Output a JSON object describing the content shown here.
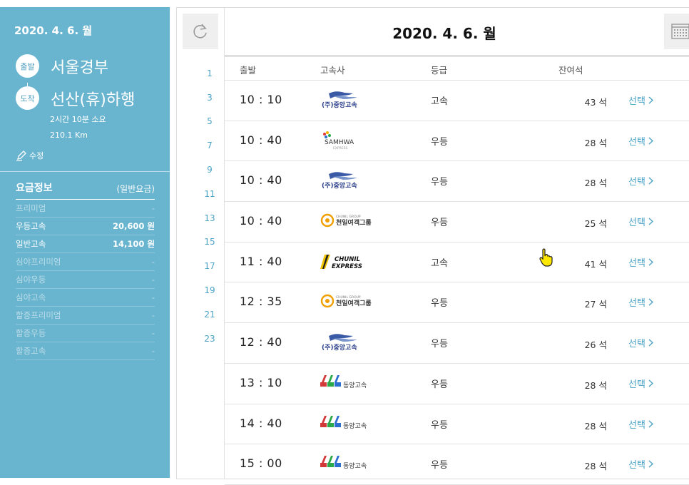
{
  "sidebar": {
    "date": "2020. 4. 6. 월",
    "departure_badge": "출발",
    "departure": "서울경부",
    "arrival_badge": "도착",
    "arrival": "선산(휴)하행",
    "duration": "2시간 10분 소요",
    "distance": "210.1 Km",
    "edit_label": "수정",
    "fare_title": "요금정보",
    "fare_type": "(일반요금)",
    "fares": [
      {
        "label": "프리미엄",
        "price": "-",
        "active": false
      },
      {
        "label": "우등고속",
        "price": "20,600 원",
        "active": true
      },
      {
        "label": "일반고속",
        "price": "14,100 원",
        "active": true
      },
      {
        "label": "심야프리미엄",
        "price": "-",
        "active": false
      },
      {
        "label": "심야우등",
        "price": "-",
        "active": false
      },
      {
        "label": "심야고속",
        "price": "-",
        "active": false
      },
      {
        "label": "할증프리미엄",
        "price": "-",
        "active": false
      },
      {
        "label": "할증우등",
        "price": "-",
        "active": false
      },
      {
        "label": "할증고속",
        "price": "-",
        "active": false
      }
    ]
  },
  "main": {
    "date": "2020. 4. 6. 월",
    "hours": [
      "1",
      "3",
      "5",
      "7",
      "9",
      "11",
      "13",
      "15",
      "17",
      "19",
      "21",
      "23"
    ],
    "columns": {
      "departure": "출발",
      "company": "고속사",
      "grade": "등급",
      "seats": "잔여석"
    },
    "seat_unit": "석",
    "select_label": "선택",
    "rows": [
      {
        "time": "10 : 10",
        "logo": "jungang",
        "grade": "고속",
        "seats": "43"
      },
      {
        "time": "10 : 40",
        "logo": "samhwa",
        "grade": "우등",
        "seats": "28"
      },
      {
        "time": "10 : 40",
        "logo": "jungang",
        "grade": "우등",
        "seats": "28"
      },
      {
        "time": "10 : 40",
        "logo": "chunil-group",
        "grade": "우등",
        "seats": "25"
      },
      {
        "time": "11 : 40",
        "logo": "chunil-express",
        "grade": "고속",
        "seats": "41"
      },
      {
        "time": "12 : 35",
        "logo": "chunil-group",
        "grade": "우등",
        "seats": "27"
      },
      {
        "time": "12 : 40",
        "logo": "jungang",
        "grade": "우등",
        "seats": "26"
      },
      {
        "time": "13 : 10",
        "logo": "dongyang",
        "grade": "우등",
        "seats": "28"
      },
      {
        "time": "14 : 40",
        "logo": "dongyang",
        "grade": "우등",
        "seats": "28"
      },
      {
        "time": "15 : 00",
        "logo": "dongyang",
        "grade": "우등",
        "seats": "28"
      }
    ]
  },
  "logos": {
    "jungang": "(주)중앙고속",
    "samhwa": "SAMHWA",
    "samhwa_sub": "EXPRESS",
    "chunil_group": "천일여객그룹",
    "chunil_group_sub": "CHUNIL GROUP",
    "chunil_express_1": "CHUNIL",
    "chunil_express_2": "EXPRESS",
    "dongyang": "동양고속"
  },
  "colors": {
    "sidebar_bg": "#69b4cf",
    "accent": "#4aa3c6"
  }
}
